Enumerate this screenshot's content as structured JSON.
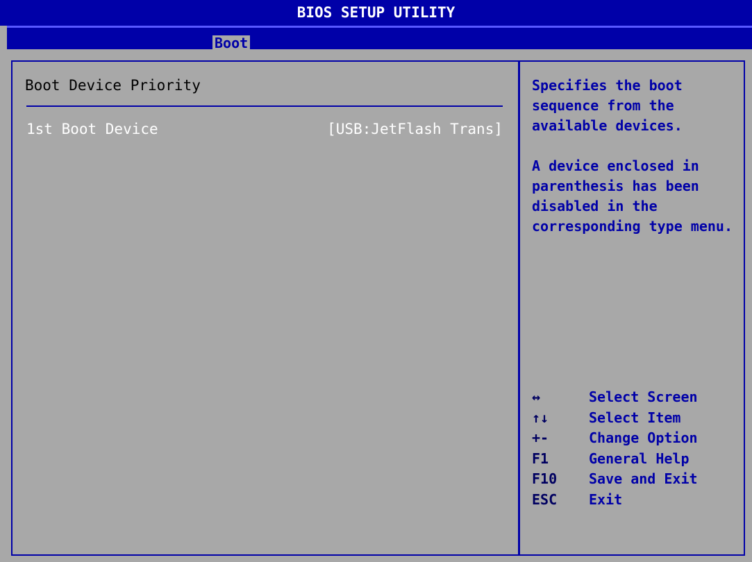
{
  "window": {
    "title": "BIOS SETUP UTILITY"
  },
  "menu": {
    "active_tab": "Boot"
  },
  "main": {
    "section_title": "Boot Device Priority",
    "settings": [
      {
        "label": "1st Boot Device",
        "value": "[USB:JetFlash Trans]"
      }
    ]
  },
  "help": {
    "paragraphs": [
      "Specifies the boot sequence from the available devices.",
      "A device enclosed in parenthesis has been disabled in the corresponding type menu."
    ]
  },
  "keys": [
    {
      "key": "↔",
      "action": "Select Screen"
    },
    {
      "key": "↑↓",
      "action": "Select Item"
    },
    {
      "key": "+-",
      "action": "Change Option"
    },
    {
      "key": "F1",
      "action": "General Help"
    },
    {
      "key": "F10",
      "action": "Save and Exit"
    },
    {
      "key": "ESC",
      "action": "Exit"
    }
  ],
  "colors": {
    "background": "#a8a8a8",
    "bios_blue": "#0000a8",
    "text_white": "#ffffff"
  }
}
